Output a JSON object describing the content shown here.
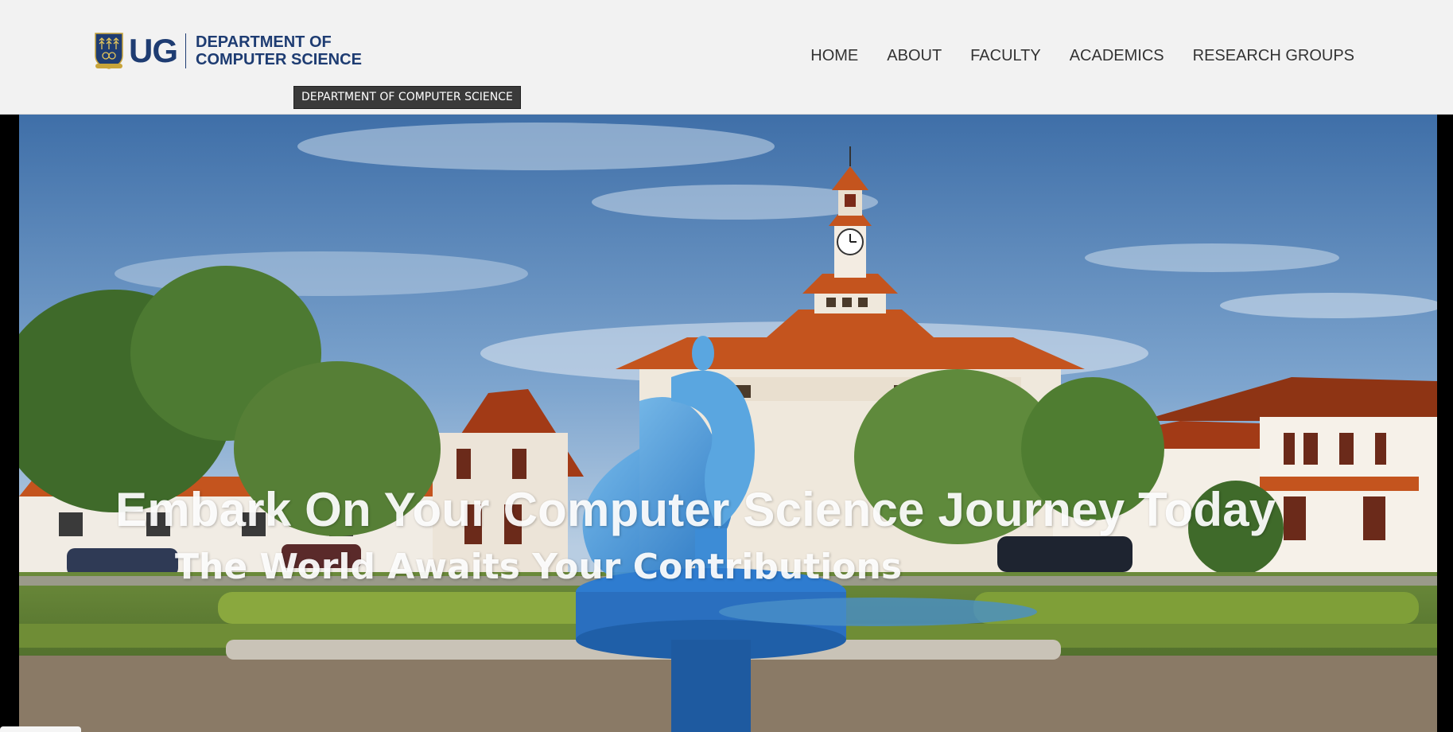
{
  "header": {
    "logo": {
      "mark": "UG",
      "line1": "DEPARTMENT OF",
      "line2": "COMPUTER SCIENCE",
      "crest_icon": "university-crest-icon",
      "brand_color": "#1e3c72"
    },
    "nav": [
      {
        "label": "HOME"
      },
      {
        "label": "ABOUT"
      },
      {
        "label": "FACULTY"
      },
      {
        "label": "ACADEMICS"
      },
      {
        "label": "RESEARCH GROUPS"
      }
    ],
    "tooltip": "DEPARTMENT OF COMPUTER SCIENCE"
  },
  "hero": {
    "title": "Embark On Your Computer Science Journey Today",
    "subtitle": "The World Awaits Your Contributions"
  }
}
